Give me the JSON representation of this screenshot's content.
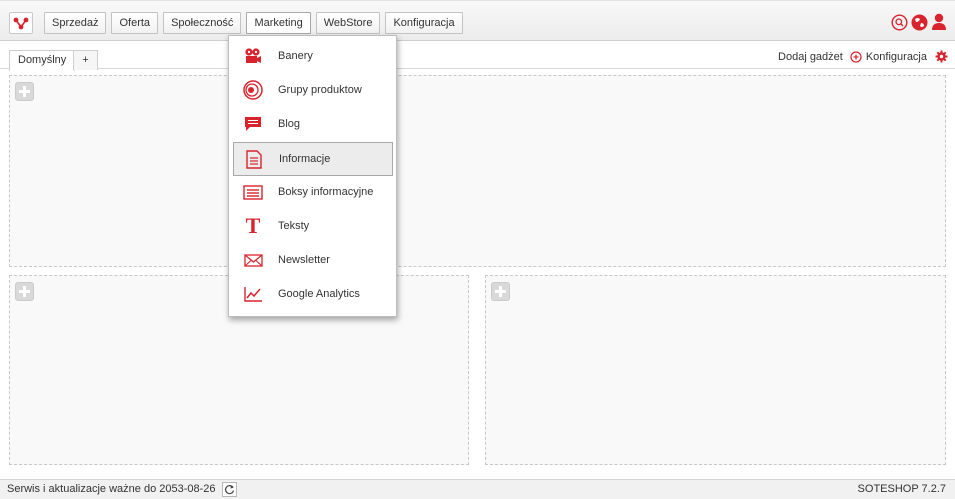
{
  "colors": {
    "accent": "#d9232d"
  },
  "topbar": {
    "menu": [
      {
        "label": "Sprzedaż",
        "name": "menu-sprzedaz"
      },
      {
        "label": "Oferta",
        "name": "menu-oferta"
      },
      {
        "label": "Społeczność",
        "name": "menu-spolecznosc"
      },
      {
        "label": "Marketing",
        "name": "menu-marketing",
        "active": true
      },
      {
        "label": "WebStore",
        "name": "menu-webstore"
      },
      {
        "label": "Konfiguracja",
        "name": "menu-konfiguracja"
      }
    ],
    "icons": [
      "search-icon",
      "globe-icon",
      "user-icon"
    ]
  },
  "tabs": {
    "items": [
      "Domyślny",
      "+"
    ],
    "add_gadget": "Dodaj gadżet",
    "config": "Konfiguracja"
  },
  "dropdown": {
    "items": [
      {
        "label": "Banery",
        "icon": "camera-icon"
      },
      {
        "label": "Grupy produktow",
        "icon": "product-group-icon"
      },
      {
        "label": "Blog",
        "icon": "speech-bubble-icon"
      },
      {
        "label": "Informacje",
        "icon": "document-icon",
        "hover": true
      },
      {
        "label": "Boksy informacyjne",
        "icon": "info-box-icon"
      },
      {
        "label": "Teksty",
        "icon": "text-t-icon"
      },
      {
        "label": "Newsletter",
        "icon": "envelope-icon"
      },
      {
        "label": "Google Analytics",
        "icon": "chart-line-icon"
      }
    ]
  },
  "footer": {
    "left": "Serwis i aktualizacje ważne do 2053-08-26",
    "right": "SOTESHOP 7.2.7"
  }
}
